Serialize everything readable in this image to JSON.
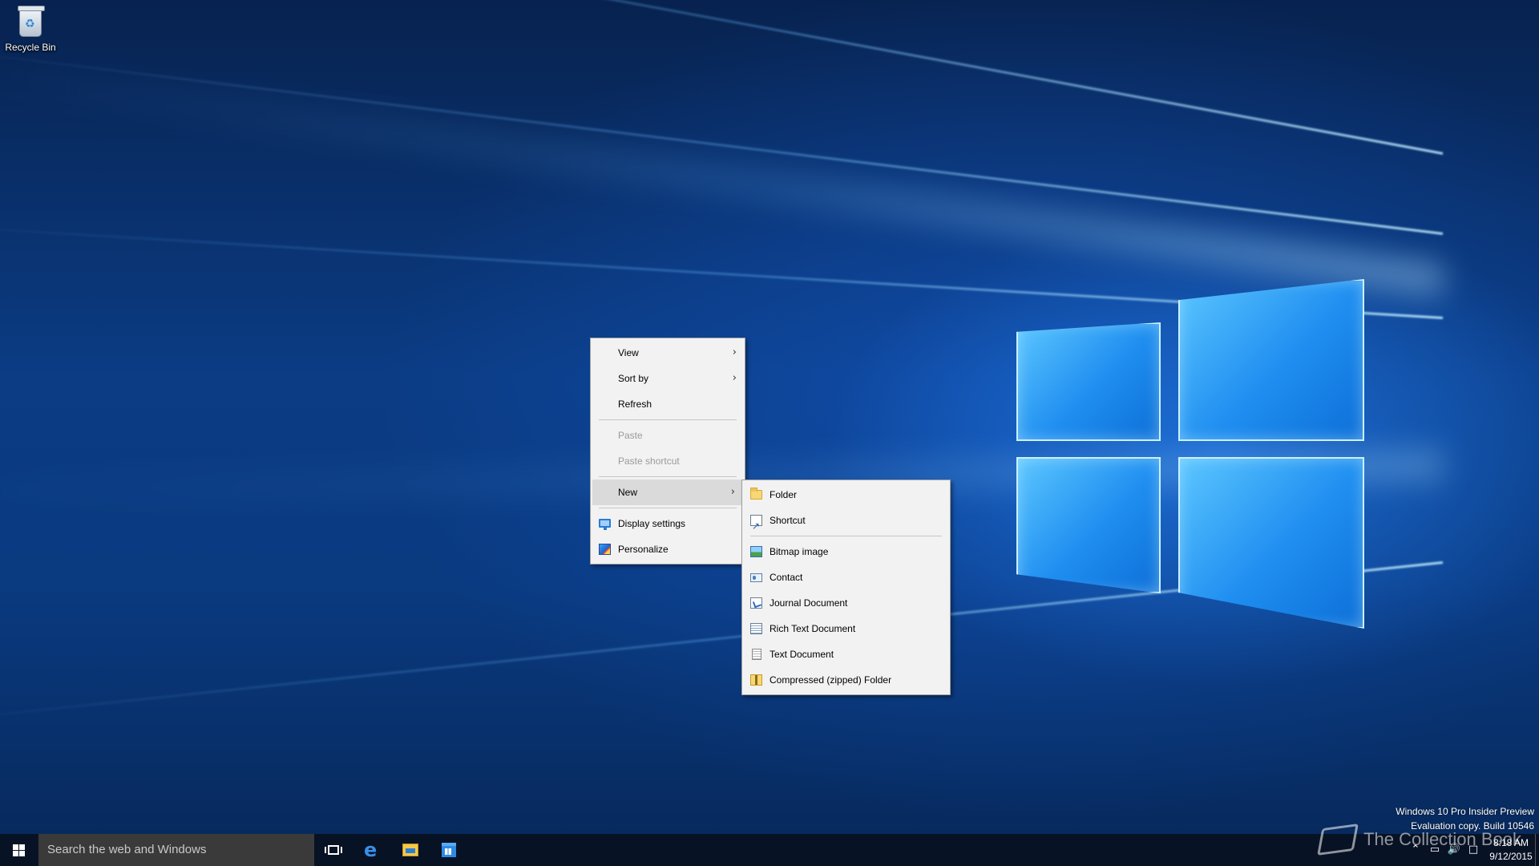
{
  "desktop": {
    "icons": [
      {
        "label": "Recycle Bin",
        "icon": "recycle-bin-icon"
      }
    ],
    "watermark": {
      "line1": "Windows 10 Pro Insider Preview",
      "line2": "Evaluation copy. Build 10546"
    }
  },
  "context_menu": {
    "items": [
      {
        "label": "View",
        "has_submenu": true,
        "enabled": true
      },
      {
        "label": "Sort by",
        "has_submenu": true,
        "enabled": true
      },
      {
        "label": "Refresh",
        "enabled": true
      },
      {
        "label": "Paste",
        "enabled": false
      },
      {
        "label": "Paste shortcut",
        "enabled": false
      },
      {
        "label": "New",
        "has_submenu": true,
        "enabled": true,
        "highlighted": true
      },
      {
        "label": "Display settings",
        "icon": "display-icon",
        "enabled": true
      },
      {
        "label": "Personalize",
        "icon": "personalize-icon",
        "enabled": true
      }
    ]
  },
  "new_submenu": {
    "items": [
      {
        "label": "Folder",
        "icon": "folder-icon"
      },
      {
        "label": "Shortcut",
        "icon": "shortcut-icon"
      },
      {
        "label": "Bitmap image",
        "icon": "bitmap-icon"
      },
      {
        "label": "Contact",
        "icon": "contact-icon"
      },
      {
        "label": "Journal Document",
        "icon": "journal-icon"
      },
      {
        "label": "Rich Text Document",
        "icon": "rich-text-icon"
      },
      {
        "label": "Text Document",
        "icon": "text-document-icon"
      },
      {
        "label": "Compressed (zipped) Folder",
        "icon": "zip-folder-icon"
      }
    ]
  },
  "taskbar": {
    "search_placeholder": "Search the web and Windows",
    "pinned": [
      "task-view-icon",
      "edge-icon",
      "file-explorer-icon",
      "store-icon"
    ],
    "clock": {
      "time": "8:18 AM",
      "date": "9/12/2015"
    },
    "tray_icons": [
      "chevron-up-icon",
      "network-icon",
      "volume-icon",
      "action-center-icon"
    ]
  },
  "brand_watermark": "The Collection Book",
  "colors": {
    "menu_bg": "#f2f2f2",
    "menu_highlight": "#dadada",
    "taskbar_bg": "#08121f",
    "search_bg": "#3a3a3a",
    "accent": "#1f8ef0"
  }
}
